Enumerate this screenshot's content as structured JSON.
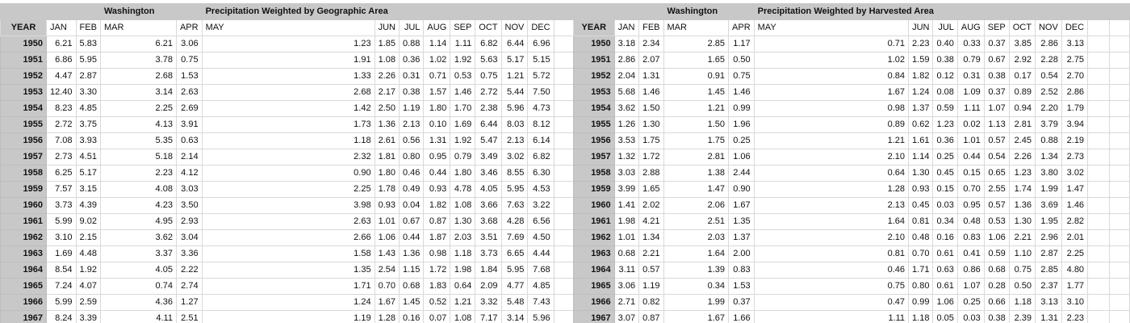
{
  "left": {
    "title_washington": "Washington",
    "title_main": "Precipitation Weighted by Geographic Area",
    "headers": [
      "YEAR",
      "JAN",
      "FEB",
      "MAR",
      "APR",
      "MAY",
      "JUN",
      "JUL",
      "AUG",
      "SEP",
      "OCT",
      "NOV",
      "DEC"
    ],
    "rows": [
      [
        "1950",
        "6.21",
        "5.83",
        "6.21",
        "3.06",
        "1.23",
        "1.85",
        "0.88",
        "1.14",
        "1.11",
        "6.82",
        "6.44",
        "6.96"
      ],
      [
        "1951",
        "6.86",
        "5.95",
        "3.78",
        "0.75",
        "1.91",
        "1.08",
        "0.36",
        "1.02",
        "1.92",
        "5.63",
        "5.17",
        "5.15"
      ],
      [
        "1952",
        "4.47",
        "2.87",
        "2.68",
        "1.53",
        "1.33",
        "2.26",
        "0.31",
        "0.71",
        "0.53",
        "0.75",
        "1.21",
        "5.72"
      ],
      [
        "1953",
        "12.40",
        "3.30",
        "3.14",
        "2.63",
        "2.68",
        "2.17",
        "0.38",
        "1.57",
        "1.46",
        "2.72",
        "5.44",
        "7.50"
      ],
      [
        "1954",
        "8.23",
        "4.85",
        "2.25",
        "2.69",
        "1.42",
        "2.50",
        "1.19",
        "1.80",
        "1.70",
        "2.38",
        "5.96",
        "4.73"
      ],
      [
        "1955",
        "2.72",
        "3.75",
        "4.13",
        "3.91",
        "1.73",
        "1.36",
        "2.13",
        "0.10",
        "1.69",
        "6.44",
        "8.03",
        "8.12"
      ],
      [
        "1956",
        "7.08",
        "3.93",
        "5.35",
        "0.63",
        "1.18",
        "2.61",
        "0.56",
        "1.31",
        "1.92",
        "5.47",
        "2.13",
        "6.14"
      ],
      [
        "1957",
        "2.73",
        "4.51",
        "5.18",
        "2.14",
        "2.32",
        "1.81",
        "0.80",
        "0.95",
        "0.79",
        "3.49",
        "3.02",
        "6.82"
      ],
      [
        "1958",
        "6.25",
        "5.17",
        "2.23",
        "4.12",
        "0.90",
        "1.80",
        "0.46",
        "0.44",
        "1.80",
        "3.46",
        "8.55",
        "6.30"
      ],
      [
        "1959",
        "7.57",
        "3.15",
        "4.08",
        "3.03",
        "2.25",
        "1.78",
        "0.49",
        "0.93",
        "4.78",
        "4.05",
        "5.95",
        "4.53"
      ],
      [
        "1960",
        "3.73",
        "4.39",
        "4.23",
        "3.50",
        "3.98",
        "0.93",
        "0.04",
        "1.82",
        "1.08",
        "3.66",
        "7.63",
        "3.22"
      ],
      [
        "1961",
        "5.99",
        "9.02",
        "4.95",
        "2.93",
        "2.63",
        "1.01",
        "0.67",
        "0.87",
        "1.30",
        "3.68",
        "4.28",
        "6.56"
      ],
      [
        "1962",
        "3.10",
        "2.15",
        "3.62",
        "3.04",
        "2.66",
        "1.06",
        "0.44",
        "1.87",
        "2.03",
        "3.51",
        "7.69",
        "4.50"
      ],
      [
        "1963",
        "1.69",
        "4.48",
        "3.37",
        "3.36",
        "1.58",
        "1.43",
        "1.36",
        "0.98",
        "1.18",
        "3.73",
        "6.65",
        "4.44"
      ],
      [
        "1964",
        "8.54",
        "1.92",
        "4.05",
        "2.22",
        "1.35",
        "2.54",
        "1.15",
        "1.72",
        "1.98",
        "1.84",
        "5.95",
        "7.68"
      ],
      [
        "1965",
        "7.24",
        "4.07",
        "0.74",
        "2.74",
        "1.71",
        "0.70",
        "0.68",
        "1.83",
        "0.64",
        "2.09",
        "4.77",
        "4.85"
      ],
      [
        "1966",
        "5.99",
        "2.59",
        "4.36",
        "1.27",
        "1.24",
        "1.67",
        "1.45",
        "0.52",
        "1.21",
        "3.32",
        "5.48",
        "7.43"
      ],
      [
        "1967",
        "8.24",
        "3.39",
        "4.11",
        "2.51",
        "1.19",
        "1.28",
        "0.16",
        "0.07",
        "1.08",
        "7.17",
        "3.14",
        "5.96"
      ]
    ]
  },
  "right": {
    "title_washington": "Washington",
    "title_main": "Precipitation Weighted by Harvested Area",
    "headers": [
      "YEAR",
      "JAN",
      "FEB",
      "MAR",
      "APR",
      "MAY",
      "JUN",
      "JUL",
      "AUG",
      "SEP",
      "OCT",
      "NOV",
      "DEC"
    ],
    "rows": [
      [
        "1950",
        "3.18",
        "2.34",
        "2.85",
        "1.17",
        "0.71",
        "2.23",
        "0.40",
        "0.33",
        "0.37",
        "3.85",
        "2.86",
        "3.13"
      ],
      [
        "1951",
        "2.86",
        "2.07",
        "1.65",
        "0.50",
        "1.02",
        "1.59",
        "0.38",
        "0.79",
        "0.67",
        "2.92",
        "2.28",
        "2.75"
      ],
      [
        "1952",
        "2.04",
        "1.31",
        "0.91",
        "0.75",
        "0.84",
        "1.82",
        "0.12",
        "0.31",
        "0.38",
        "0.17",
        "0.54",
        "2.70"
      ],
      [
        "1953",
        "5.68",
        "1.46",
        "1.45",
        "1.46",
        "1.67",
        "1.24",
        "0.08",
        "1.09",
        "0.37",
        "0.89",
        "2.52",
        "2.86"
      ],
      [
        "1954",
        "3.62",
        "1.50",
        "1.21",
        "0.99",
        "0.98",
        "1.37",
        "0.59",
        "1.11",
        "1.07",
        "0.94",
        "2.20",
        "1.79"
      ],
      [
        "1955",
        "1.26",
        "1.30",
        "1.50",
        "1.96",
        "0.89",
        "0.62",
        "1.23",
        "0.02",
        "1.13",
        "2.81",
        "3.79",
        "3.94"
      ],
      [
        "1956",
        "3.53",
        "1.75",
        "1.75",
        "0.25",
        "1.21",
        "1.61",
        "0.36",
        "1.01",
        "0.57",
        "2.45",
        "0.88",
        "2.19"
      ],
      [
        "1957",
        "1.32",
        "1.72",
        "2.81",
        "1.06",
        "2.10",
        "1.14",
        "0.25",
        "0.44",
        "0.54",
        "2.26",
        "1.34",
        "2.73"
      ],
      [
        "1958",
        "3.03",
        "2.88",
        "1.38",
        "2.44",
        "0.64",
        "1.30",
        "0.45",
        "0.15",
        "0.65",
        "1.23",
        "3.80",
        "3.02"
      ],
      [
        "1959",
        "3.99",
        "1.65",
        "1.47",
        "0.90",
        "1.28",
        "0.93",
        "0.15",
        "0.70",
        "2.55",
        "1.74",
        "1.99",
        "1.47"
      ],
      [
        "1960",
        "1.41",
        "2.02",
        "2.06",
        "1.67",
        "2.13",
        "0.45",
        "0.03",
        "0.95",
        "0.57",
        "1.36",
        "3.69",
        "1.46"
      ],
      [
        "1961",
        "1.98",
        "4.21",
        "2.51",
        "1.35",
        "1.64",
        "0.81",
        "0.34",
        "0.48",
        "0.53",
        "1.30",
        "1.95",
        "2.82"
      ],
      [
        "1962",
        "1.01",
        "1.34",
        "2.03",
        "1.37",
        "2.10",
        "0.48",
        "0.16",
        "0.83",
        "1.06",
        "2.21",
        "2.96",
        "2.01"
      ],
      [
        "1963",
        "0.68",
        "2.21",
        "1.64",
        "2.00",
        "0.81",
        "0.70",
        "0.61",
        "0.41",
        "0.59",
        "1.10",
        "2.87",
        "2.25"
      ],
      [
        "1964",
        "3.11",
        "0.57",
        "1.39",
        "0.83",
        "0.46",
        "1.71",
        "0.63",
        "0.86",
        "0.68",
        "0.75",
        "2.85",
        "4.80"
      ],
      [
        "1965",
        "3.06",
        "1.19",
        "0.34",
        "1.53",
        "0.75",
        "0.80",
        "0.61",
        "1.07",
        "0.28",
        "0.50",
        "2.37",
        "1.77"
      ],
      [
        "1966",
        "2.71",
        "0.82",
        "1.99",
        "0.37",
        "0.47",
        "0.99",
        "1.06",
        "0.25",
        "0.66",
        "1.18",
        "3.13",
        "3.10"
      ],
      [
        "1967",
        "3.07",
        "0.87",
        "1.67",
        "1.66",
        "1.11",
        "1.18",
        "0.05",
        "0.03",
        "0.38",
        "2.39",
        "1.31",
        "2.23"
      ]
    ]
  }
}
